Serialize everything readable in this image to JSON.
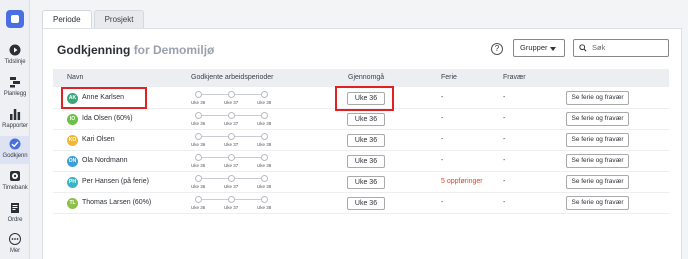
{
  "sidebar": {
    "items": [
      {
        "label": "Tidslinje",
        "icon": "play-circle-icon"
      },
      {
        "label": "Planlegg",
        "icon": "plan-bars-icon"
      },
      {
        "label": "Rapporter",
        "icon": "bar-chart-icon"
      },
      {
        "label": "Godkjenn",
        "icon": "check-circle-icon",
        "active": true
      },
      {
        "label": "Timebank",
        "icon": "timebank-icon"
      },
      {
        "label": "Ordre",
        "icon": "document-icon"
      },
      {
        "label": "Mer",
        "icon": "more-dots-icon"
      }
    ]
  },
  "tabs": [
    {
      "label": "Periode",
      "active": true
    },
    {
      "label": "Prosjekt",
      "active": false
    }
  ],
  "header": {
    "title": "Godkjenning",
    "subtitle": "for Demomiljø",
    "help": "?",
    "group_select": "Grupper",
    "search_placeholder": "Søk"
  },
  "table": {
    "columns": {
      "name": "Navn",
      "approved": "Godkjente arbeidsperioder",
      "review": "Gjennomgå",
      "vacation": "Ferie",
      "absence": "Fravær"
    },
    "weeks": [
      "Uke 36",
      "Uke 37",
      "Uke 38"
    ],
    "rows": [
      {
        "initials": "AK",
        "name": "Anne Karlsen",
        "avatar_color": "#3aa87a",
        "review": "Uke 36",
        "vacation": "-",
        "vacation_warn": false,
        "absence": "-",
        "action": "Se ferie og fravær"
      },
      {
        "initials": "IO",
        "name": "Ida Olsen (60%)",
        "avatar_color": "#6cc04a",
        "review": "Uke 36",
        "vacation": "-",
        "vacation_warn": false,
        "absence": "-",
        "action": "Se ferie og fravær"
      },
      {
        "initials": "KO",
        "name": "Kari Olsen",
        "avatar_color": "#f2b632",
        "review": "Uke 36",
        "vacation": "-",
        "vacation_warn": false,
        "absence": "-",
        "action": "Se ferie og fravær"
      },
      {
        "initials": "ON",
        "name": "Ola Nordmann",
        "avatar_color": "#3b9fd8",
        "review": "Uke 36",
        "vacation": "-",
        "vacation_warn": false,
        "absence": "-",
        "action": "Se ferie og fravær"
      },
      {
        "initials": "PH",
        "name": "Per Hansen (på ferie)",
        "avatar_color": "#3bb3c4",
        "review": "Uke 36",
        "vacation": "5 oppføringer",
        "vacation_warn": true,
        "absence": "-",
        "action": "Se ferie og fravær"
      },
      {
        "initials": "TL",
        "name": "Thomas Larsen (60%)",
        "avatar_color": "#8cc04a",
        "review": "Uke 36",
        "vacation": "-",
        "vacation_warn": false,
        "absence": "-",
        "action": "Se ferie og fravær"
      }
    ]
  },
  "colors": {
    "accent": "#4a6fe3",
    "warning": "#e0452b",
    "highlight": "#e02222"
  }
}
